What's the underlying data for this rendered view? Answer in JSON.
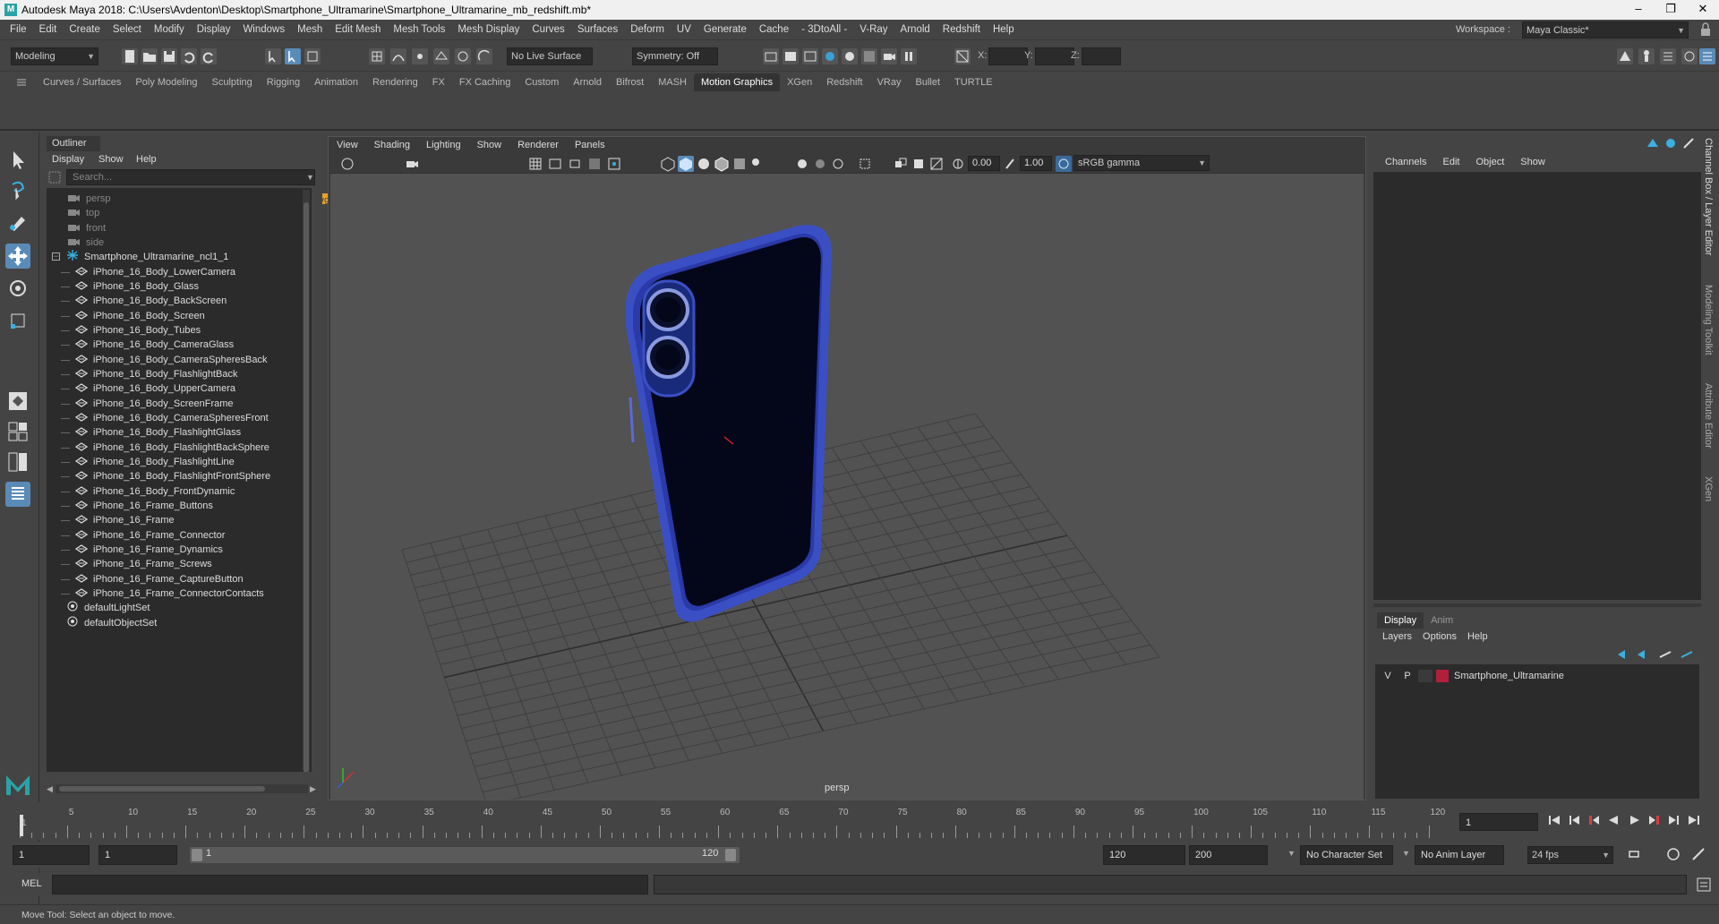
{
  "window": {
    "title": "Autodesk Maya 2018: C:\\Users\\Avdenton\\Desktop\\Smartphone_Ultramarine\\Smartphone_Ultramarine_mb_redshift.mb*",
    "minimize": "–",
    "maximize": "❐",
    "close": "✕"
  },
  "menu": [
    "File",
    "Edit",
    "Create",
    "Select",
    "Modify",
    "Display",
    "Windows",
    "Mesh",
    "Edit Mesh",
    "Mesh Tools",
    "Mesh Display",
    "Curves",
    "Surfaces",
    "Deform",
    "UV",
    "Generate",
    "Cache",
    "- 3DtoAll -",
    "V-Ray",
    "Arnold",
    "Redshift",
    "Help"
  ],
  "workspace": {
    "label": "Workspace :",
    "value": "Maya Classic*"
  },
  "statusline": {
    "mode": "Modeling",
    "live_surface": "No Live Surface",
    "symmetry": "Symmetry: Off",
    "x_label": "X:",
    "y_label": "Y:",
    "z_label": "Z:"
  },
  "shelf_tabs": [
    "Curves / Surfaces",
    "Poly Modeling",
    "Sculpting",
    "Rigging",
    "Animation",
    "Rendering",
    "FX",
    "FX Caching",
    "Custom",
    "Arnold",
    "Bifrost",
    "MASH",
    "Motion Graphics",
    "XGen",
    "Redshift",
    "VRay",
    "Bullet",
    "TURTLE"
  ],
  "shelf_active": "Motion Graphics",
  "outliner": {
    "title": "Outliner",
    "menu": [
      "Display",
      "Show",
      "Help"
    ],
    "search_placeholder": "Search...",
    "cameras": [
      "persp",
      "top",
      "front",
      "side"
    ],
    "group": "Smartphone_Ultramarine_ncl1_1",
    "children": [
      "iPhone_16_Body_LowerCamera",
      "iPhone_16_Body_Glass",
      "iPhone_16_Body_BackScreen",
      "iPhone_16_Body_Screen",
      "iPhone_16_Body_Tubes",
      "iPhone_16_Body_CameraGlass",
      "iPhone_16_Body_CameraSpheresBack",
      "iPhone_16_Body_FlashlightBack",
      "iPhone_16_Body_UpperCamera",
      "iPhone_16_Body_ScreenFrame",
      "iPhone_16_Body_CameraSpheresFront",
      "iPhone_16_Body_FlashlightGlass",
      "iPhone_16_Body_FlashlightBackSphere",
      "iPhone_16_Body_FlashlightLine",
      "iPhone_16_Body_FlashlightFrontSphere",
      "iPhone_16_Body_FrontDynamic",
      "iPhone_16_Frame_Buttons",
      "iPhone_16_Frame",
      "iPhone_16_Frame_Connector",
      "iPhone_16_Frame_Dynamics",
      "iPhone_16_Frame_Screws",
      "iPhone_16_Frame_CaptureButton",
      "iPhone_16_Frame_ConnectorContacts"
    ],
    "sets": [
      "defaultLightSet",
      "defaultObjectSet"
    ]
  },
  "viewport": {
    "menu": [
      "View",
      "Shading",
      "Lighting",
      "Show",
      "Renderer",
      "Panels"
    ],
    "exposure": "0.00",
    "gamma": "1.00",
    "colorspace": "sRGB gamma",
    "camera_label": "persp"
  },
  "channelbox": {
    "menu": [
      "Channels",
      "Edit",
      "Object",
      "Show"
    ]
  },
  "layers": {
    "tabs": [
      "Display",
      "Anim"
    ],
    "menu": [
      "Layers",
      "Options",
      "Help"
    ],
    "items": [
      {
        "v": "V",
        "p": "P",
        "name": "Smartphone_Ultramarine",
        "color": "#b0203a"
      }
    ]
  },
  "side_tabs": [
    "Channel Box / Layer Editor",
    "Modeling Toolkit",
    "Attribute Editor",
    "XGen"
  ],
  "timeline": {
    "ticks": [
      "1",
      "5",
      "10",
      "15",
      "20",
      "25",
      "30",
      "35",
      "40",
      "45",
      "50",
      "55",
      "60",
      "65",
      "70",
      "75",
      "80",
      "85",
      "90",
      "95",
      "100",
      "105",
      "110",
      "115",
      "120"
    ],
    "current_frame": "1"
  },
  "range": {
    "start": "1",
    "start_inner": "1",
    "slider_start": "1",
    "slider_end": "120",
    "end_inner": "120",
    "end": "200",
    "character_set": "No Character Set",
    "anim_layer": "No Anim Layer",
    "fps": "24 fps"
  },
  "cmd": {
    "label": "MEL"
  },
  "help": {
    "text": "Move Tool: Select an object to move."
  },
  "colors": {
    "phone_frame": "#3b4fc4",
    "phone_back": "#04071a",
    "selection": "#5a8bb8"
  }
}
